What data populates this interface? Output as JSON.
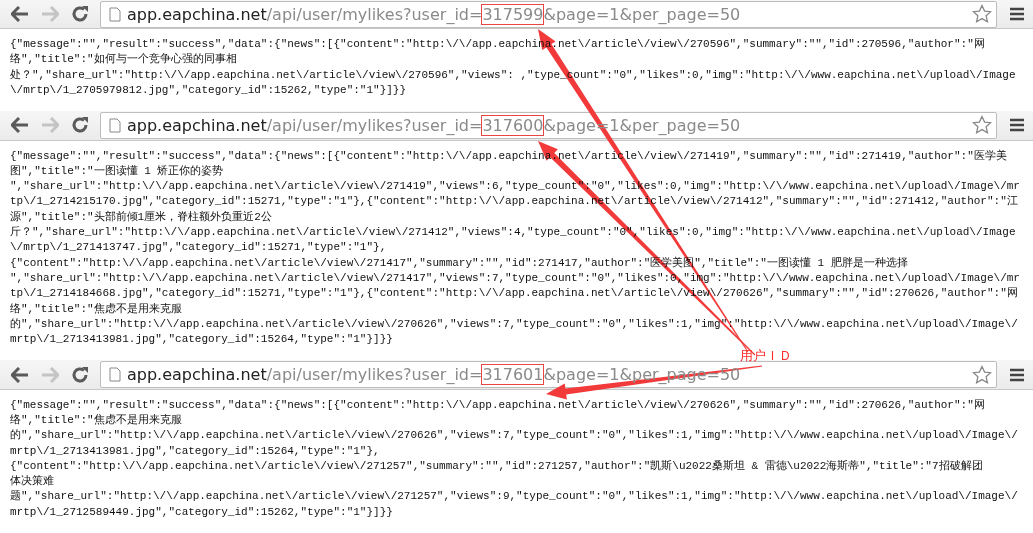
{
  "windows": [
    {
      "forward_disabled": true,
      "url": {
        "host": "app.eapchina.net",
        "path": "/api/user/mylikes?user_id=",
        "user_id": "317599",
        "query": "&page=1&per_page=50"
      },
      "lines": [
        "{\"message\":\"\",\"result\":\"success\",\"data\":{\"news\":[{\"content\":\"http:\\/\\/app.eapchina.net\\/article\\/view\\/270596\",\"summary\":\"\",\"id\":270596,\"author\":\"网",
        "络\",\"title\":\"如何与一个竞争心强的同事相",
        "处？\",\"share_url\":\"http:\\/\\/app.eapchina.net\\/article\\/view\\/270596\",\"views\": ,\"type_count\":\"0\",\"likes\":0,\"img\":\"http:\\/\\/www.eapchina.net\\/upload\\/Image",
        "\\/mrtp\\/1_2705979812.jpg\",\"category_id\":15262,\"type\":\"1\"}]}}"
      ]
    },
    {
      "forward_disabled": true,
      "url": {
        "host": "app.eapchina.net",
        "path": "/api/user/mylikes?user_id=",
        "user_id": "317600",
        "query": "&page=1&per_page=50"
      },
      "lines": [
        "{\"message\":\"\",\"result\":\"success\",\"data\":{\"news\":[{\"content\":\"http:\\/\\/app.eapchina.net\\/article\\/view\\/271419\",\"summary\":\"\",\"id\":271419,\"author\":\"医学美",
        "图\",\"title\":\"一图读懂 1 矫正你的姿势",
        "\",\"share_url\":\"http:\\/\\/app.eapchina.net\\/article\\/view\\/271419\",\"views\":6,\"type_count\":\"0\",\"likes\":0,\"img\":\"http:\\/\\/www.eapchina.net\\/upload\\/Image\\/mr",
        "tp\\/1_2714215170.jpg\",\"category_id\":15271,\"type\":\"1\"},{\"content\":\"http:\\/\\/app.eapchina.net\\/article\\/view\\/271412\",\"summary\":\"\",\"id\":271412,\"author\":\"江",
        "源\",\"title\":\"头部前倾1厘米，脊柱额外负重近2公",
        "斤？\",\"share_url\":\"http:\\/\\/app.eapchina.net\\/article\\/view\\/271412\",\"views\":4,\"type_count\":\"0\",\"likes\":0,\"img\":\"http:\\/\\/www.eapchina.net\\/upload\\/Image",
        "\\/mrtp\\/1_271413747.jpg\",\"category_id\":15271,\"type\":\"1\"},",
        "{\"content\":\"http:\\/\\/app.eapchina.net\\/article\\/view\\/271417\",\"summary\":\"\",\"id\":271417,\"author\":\"医学美图\",\"title\":\"一图读懂 1 肥胖是一种选择",
        "\",\"share_url\":\"http:\\/\\/app.eapchina.net\\/article\\/view\\/271417\",\"views\":7,\"type_count\":\"0\",\"likes\":0,\"img\":\"http:\\/\\/www.eapchina.net\\/upload\\/Image\\/mr",
        "tp\\/1_2714184668.jpg\",\"category_id\":15271,\"type\":\"1\"},{\"content\":\"http:\\/\\/app.eapchina.net\\/article\\/view\\/270626\",\"summary\":\"\",\"id\":270626,\"author\":\"网",
        "络\",\"title\":\"焦虑不是用来克服",
        "的\",\"share_url\":\"http:\\/\\/app.eapchina.net\\/article\\/view\\/270626\",\"views\":7,\"type_count\":\"0\",\"likes\":1,\"img\":\"http:\\/\\/www.eapchina.net\\/upload\\/Image\\/",
        "mrtp\\/1_2713413981.jpg\",\"category_id\":15264,\"type\":\"1\"}]}}"
      ]
    },
    {
      "forward_disabled": true,
      "url": {
        "host": "app.eapchina.net",
        "path": "/api/user/mylikes?user_id=",
        "user_id": "317601",
        "query": "&page=1&per_page=50"
      },
      "lines": [
        "{\"message\":\"\",\"result\":\"success\",\"data\":{\"news\":[{\"content\":\"http:\\/\\/app.eapchina.net\\/article\\/view\\/270626\",\"summary\":\"\",\"id\":270626,\"author\":\"网",
        "络\",\"title\":\"焦虑不是用来克服",
        "的\",\"share_url\":\"http:\\/\\/app.eapchina.net\\/article\\/view\\/270626\",\"views\":7,\"type_count\":\"0\",\"likes\":1,\"img\":\"http:\\/\\/www.eapchina.net\\/upload\\/Image\\/",
        "mrtp\\/1_2713413981.jpg\",\"category_id\":15264,\"type\":\"1\"},",
        "{\"content\":\"http:\\/\\/app.eapchina.net\\/article\\/view\\/271257\",\"summary\":\"\",\"id\":271257,\"author\":\"凯斯\\u2022桑斯坦 & 雷德\\u2022海斯蒂\",\"title\":\"7招破解团",
        "体决策难",
        "题\",\"share_url\":\"http:\\/\\/app.eapchina.net\\/article\\/view\\/271257\",\"views\":9,\"type_count\":\"0\",\"likes\":1,\"img\":\"http:\\/\\/www.eapchina.net\\/upload\\/Image\\/",
        "mrtp\\/1_2712589449.jpg\",\"category_id\":15262,\"type\":\"1\"}]}}"
      ]
    }
  ],
  "annotation": {
    "label": "用户ＩＤ"
  }
}
